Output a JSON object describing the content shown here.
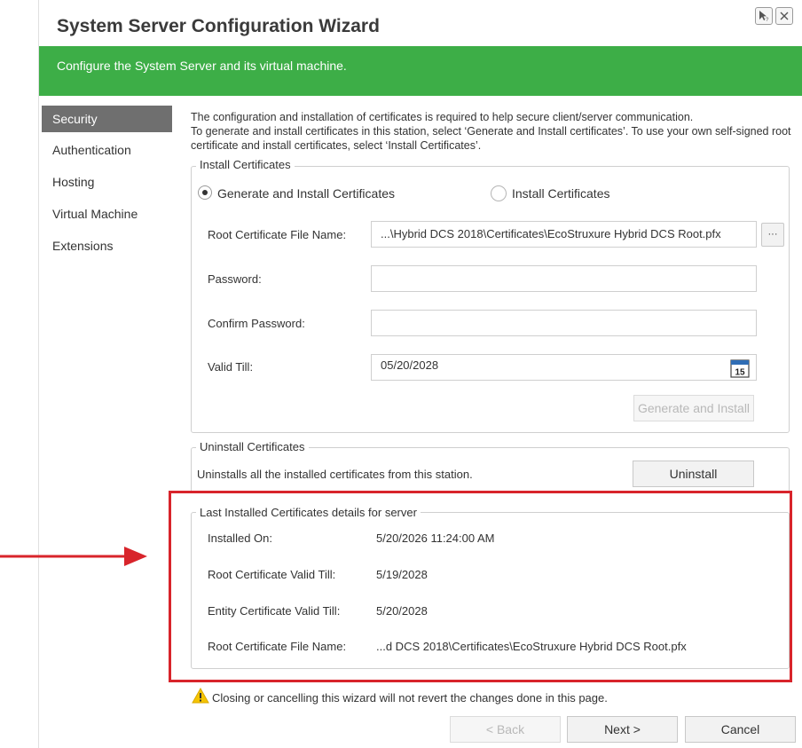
{
  "window": {
    "title": "System Server Configuration Wizard",
    "banner": "Configure the System Server and its virtual machine."
  },
  "sidebar": {
    "items": [
      {
        "label": "Security",
        "active": true
      },
      {
        "label": "Authentication"
      },
      {
        "label": "Hosting"
      },
      {
        "label": "Virtual Machine"
      },
      {
        "label": "Extensions"
      }
    ]
  },
  "description": {
    "line1": "The configuration and installation of certificates is required to help secure client/server communication.",
    "line2": "To generate and install certificates in this station, select ‘Generate and Install certificates’. To use your own self-signed root certificate and install certificates,  select ‘Install Certificates’."
  },
  "install_group": {
    "legend": "Install Certificates",
    "option_generate": "Generate and Install Certificates",
    "option_install": "Install Certificates",
    "selected": "generate",
    "root_cert_label": "Root Certificate File Name:",
    "root_cert_value": "...\\Hybrid DCS 2018\\Certificates\\EcoStruxure Hybrid DCS Root.pfx",
    "browse_label": "···",
    "password_label": "Password:",
    "password_value": "",
    "confirm_label": "Confirm Password:",
    "confirm_value": "",
    "valid_till_label": "Valid Till:",
    "valid_till_value": "05/20/2028",
    "calendar_day": "15",
    "generate_button": "Generate and Install"
  },
  "uninstall_group": {
    "legend": "Uninstall Certificates",
    "text": "Uninstalls all the installed certificates from this station.",
    "button": "Uninstall"
  },
  "last_installed": {
    "legend": "Last Installed Certificates details for server",
    "rows": [
      {
        "label": "Installed On:",
        "value": "5/20/2026 11:24:00 AM"
      },
      {
        "label": "Root Certificate Valid Till:",
        "value": "5/19/2028"
      },
      {
        "label": "Entity Certificate Valid Till:",
        "value": "5/20/2028"
      },
      {
        "label": "Root Certificate File Name:",
        "value": "...d DCS 2018\\Certificates\\EcoStruxure Hybrid DCS Root.pfx"
      }
    ]
  },
  "warning": "Closing or cancelling this wizard will not revert the changes done in this page.",
  "footer": {
    "back": "< Back",
    "next": "Next >",
    "cancel": "Cancel"
  },
  "colors": {
    "banner": "#3dae47",
    "highlight": "#d8242b",
    "sidebar_active": "#6f6f6f"
  }
}
